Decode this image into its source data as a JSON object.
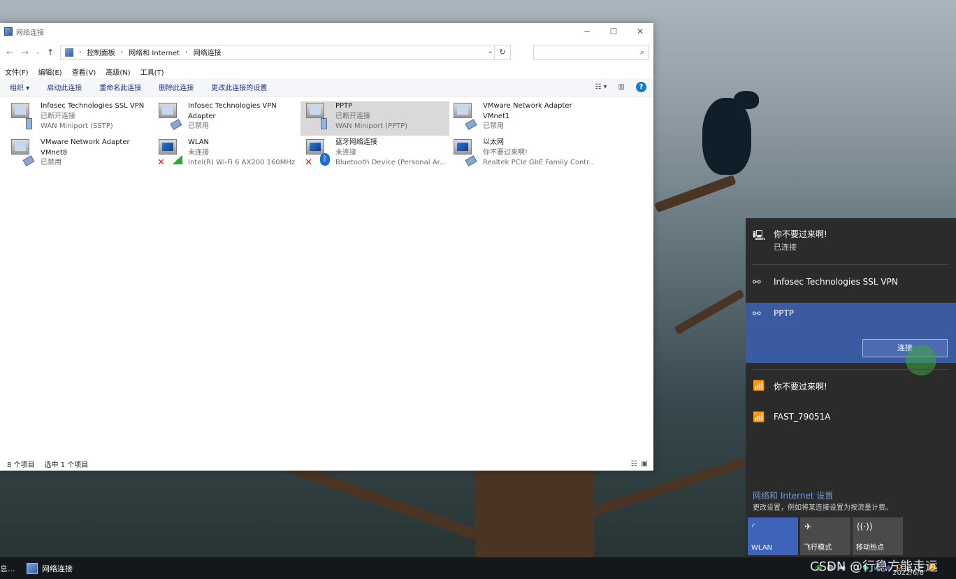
{
  "window": {
    "title": "网络连接",
    "controls": [
      "─",
      "☐",
      "✕"
    ]
  },
  "address": {
    "crumbs": [
      "控制面板",
      "网络和 Internet",
      "网络连接"
    ],
    "search_placeholder": ""
  },
  "menu": [
    "文件(F)",
    "编辑(E)",
    "查看(V)",
    "高级(N)",
    "工具(T)"
  ],
  "commands": [
    "组织 ▾",
    "启动此连接",
    "重命名此连接",
    "删除此连接",
    "更改此连接的设置"
  ],
  "connections": [
    {
      "name": "Infosec Technologies SSL VPN",
      "status": "已断开连接",
      "device": "WAN Miniport (SSTP)"
    },
    {
      "name": "Infosec Technologies VPN Adapter",
      "status": "已禁用",
      "device": ""
    },
    {
      "name": "PPTP",
      "status": "已断开连接",
      "device": "WAN Miniport (PPTP)"
    },
    {
      "name": "VMware Network Adapter VMnet1",
      "status": "已禁用",
      "device": ""
    },
    {
      "name": "VMware Network Adapter VMnet8",
      "status": "已禁用",
      "device": ""
    },
    {
      "name": "WLAN",
      "status": "未连接",
      "device": "Intel(R) Wi-Fi 6 AX200 160MHz"
    },
    {
      "name": "蓝牙网络连接",
      "status": "未连接",
      "device": "Bluetooth Device (Personal Ar..."
    },
    {
      "name": "以太网",
      "status": "你不要过来啊!",
      "device": "Realtek PCIe GbE Family Contr..."
    }
  ],
  "statusbar": {
    "count": "8 个项目",
    "selected": "选中 1 个项目"
  },
  "flyout": {
    "ethernet": {
      "name": "你不要过来啊!",
      "status": "已连接"
    },
    "vpn1": "Infosec Technologies SSL VPN",
    "vpn2": "PPTP",
    "connect_label": "连接",
    "wifi": [
      "你不要过来啊!",
      "FAST_79051A"
    ],
    "settings_title": "网络和 Internet 设置",
    "settings_desc": "更改设置，例如将某连接设置为按流量计费。",
    "tiles": [
      {
        "label": "WLAN",
        "icon": "wifi-icon"
      },
      {
        "label": "飞行模式",
        "icon": "airplane-icon"
      },
      {
        "label": "移动热点",
        "icon": "hotspot-icon"
      }
    ]
  },
  "taskbar": {
    "app_label": "网络连接",
    "left_fragment": "息...",
    "date": "2022/6/8",
    "watermark": "CSDN @行稳方能走远"
  }
}
